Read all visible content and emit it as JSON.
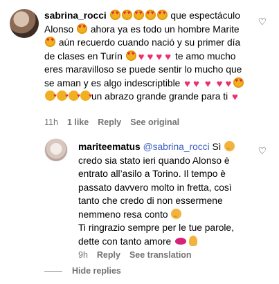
{
  "comment": {
    "username": "sabrina_rocci",
    "text1": " que espectáculo Alonso ",
    "text2": " ahora ya es todo un hombre Marite ",
    "text3": " aún recuerdo cuando nació y su primer día de clases en Turín ",
    "text4": " te amo mucho eres maravilloso se puede sentir lo mucho que se aman y es algo indescriptible ",
    "text5": "un abrazo grande grande para ti ",
    "time": "11h",
    "likes": "1 like",
    "reply": "Reply",
    "translate": "See original"
  },
  "reply_comment": {
    "username": "mariteematus",
    "mention": "@sabrina_rocci",
    "text1": " Sì ",
    "text2": " credo sia stato ieri quando Alonso è entrato all’asilo a Torino. Il tempo è passato davvero molto in fretta, così tanto che credo di non essermene nemmeno resa conto ",
    "text3": "Ti ringrazio sempre per le tue parole, dette con tanto amore ",
    "time": "9h",
    "reply": "Reply",
    "translate": "See translation"
  },
  "hide_replies": "Hide replies",
  "icons": {
    "like": "heart-outline-icon"
  }
}
